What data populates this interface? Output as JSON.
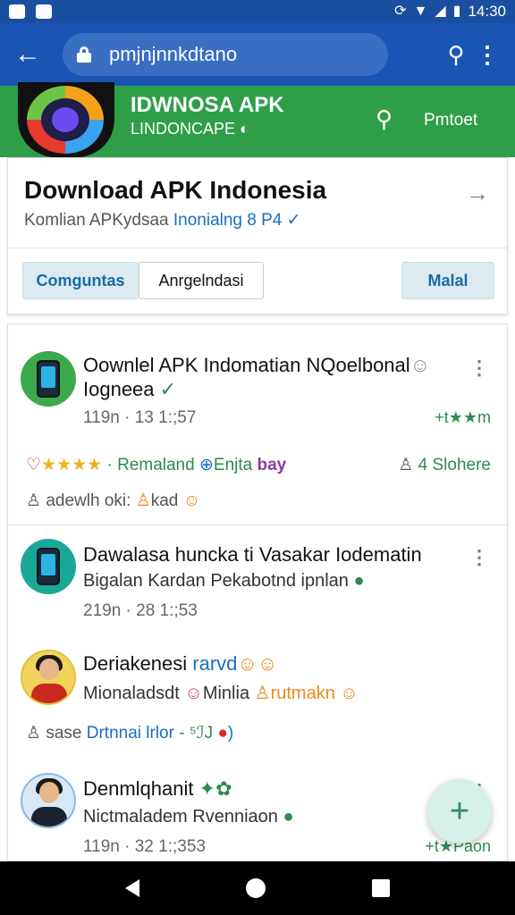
{
  "status_bar": {
    "time": "14:30"
  },
  "browser": {
    "url": "pmjnjnnkdtano"
  },
  "site_header": {
    "title": "IDWNOSA APK",
    "subtitle": "LINDONCAPE",
    "button_label": "Pmtoet"
  },
  "hero": {
    "title": "Download APK Indonesia",
    "subtitle_prefix": "Komlian APKydsaa",
    "subtitle_link": "Inonialng 8 P4",
    "chips": [
      "Comguntas",
      "Anrgelndasi",
      "Malal"
    ]
  },
  "posts": [
    {
      "title_line1": "Oownlel APK Indomatian NQoelbonal",
      "title_line2": "Iogneea",
      "time": "119n · 13 1:;57",
      "rating": "+t★★m",
      "meta_stars": "★★★★",
      "meta_text1": "· Remaland",
      "meta_text2": "Enjta",
      "meta_text3": "bay",
      "meta_right": "4 Slohere",
      "meta_line2": "adewlh oki: ",
      "meta_line2_b": "kad"
    },
    {
      "title": "Dawalasa huncka ti Vasakar Iodematin",
      "sub": "Bigalan Kardan Pekabotnd ipnlan",
      "time": "219n · 28 1:;53"
    },
    {
      "title": "Deriakenesi ",
      "title_b": "rarvd",
      "sub_a": "Mionaladsdt",
      "sub_b": "Minlia",
      "sub_c": "rutmakn",
      "meta_a": "sase",
      "meta_b": "Drtnnai lrlor",
      "meta_c": "- ⁵ℐJ",
      "meta_d": ")"
    },
    {
      "title": "Denmlqhanit",
      "sub": "Nictmaladem Rvenniaon",
      "time": "119n · 32 1:;353",
      "rating": "+t★Paon"
    }
  ]
}
